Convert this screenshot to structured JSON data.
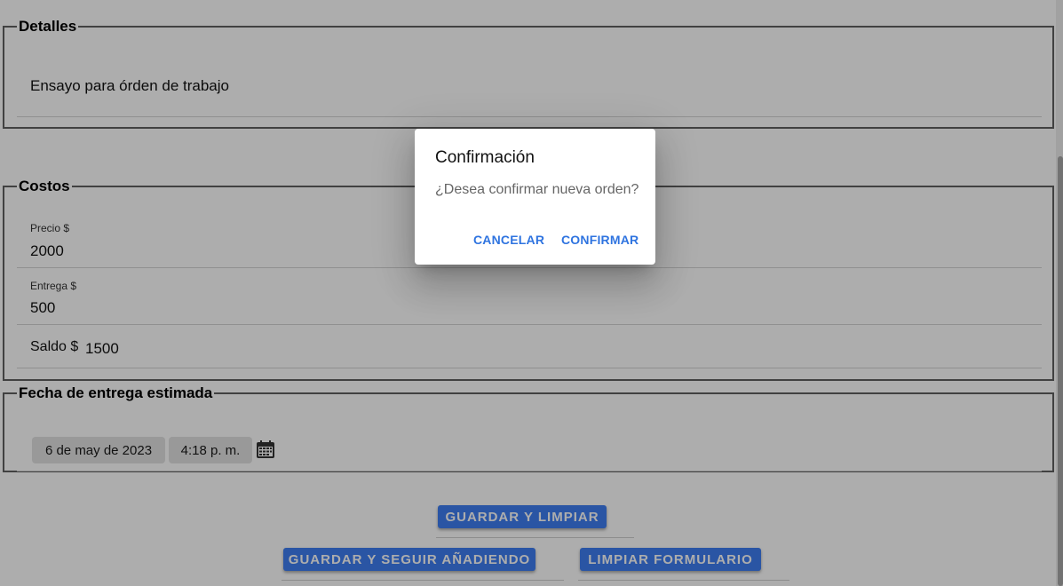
{
  "detalles": {
    "legend": "Detalles",
    "value": "Ensayo para órden de trabajo"
  },
  "costos": {
    "legend": "Costos",
    "precio_label": "Precio $",
    "precio_value": "2000",
    "entrega_label": "Entrega $",
    "entrega_value": "500",
    "saldo_label": "Saldo $",
    "saldo_value": "1500"
  },
  "fecha": {
    "legend": "Fecha de entrega estimada",
    "date": "6 de may de 2023",
    "time": "4:18 p. m.",
    "icon": "calendar-icon"
  },
  "actions": {
    "guardar_limpiar": "GUARDAR Y LIMPIAR",
    "guardar_seguir": "GUARDAR Y SEGUIR AÑADIENDO",
    "limpiar_formulario": "LIMPIAR FORMULARIO"
  },
  "dialog": {
    "title": "Confirmación",
    "message": "¿Desea confirmar nueva orden?",
    "cancel": "CANCELAR",
    "confirm": "CONFIRMAR"
  },
  "colors": {
    "accent": "#3f7ef2",
    "dialog_button": "#2f74e0",
    "overlay": "rgba(0,0,0,0.32)"
  }
}
